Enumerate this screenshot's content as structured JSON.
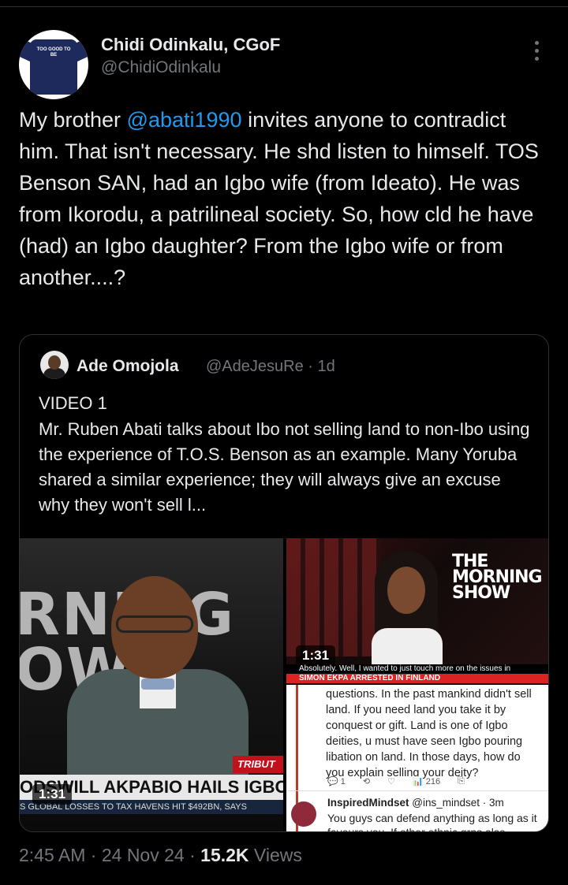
{
  "tweet": {
    "author_name": "Chidi Odinkalu, CGoF",
    "author_handle": "@ChidiOdinkalu",
    "avatar_text": "TOO GOOD TO BE",
    "text_before": "My brother ",
    "mention": "@abati1990",
    "text_after": " invites anyone to contradict him. That isn't necessary. He shd listen to himself. TOS Benson SAN, had an Igbo wife (from Ideato). He was from Ikorodu, a patrilineal society. So, how cld he have (had) an Igbo daughter? From the Igbo wife or from another....?",
    "time": "2:45 AM",
    "date": "24 Nov 24",
    "views_count": "15.2K",
    "views_label": "Views"
  },
  "quote": {
    "name": "Ade Omojola",
    "handle_time": "@AdeJesuRe · 1d",
    "label": "VIDEO 1",
    "text": "Mr. Ruben Abati talks about Ibo not selling land to non-Ibo using the experience of T.O.S. Benson as an example. Many Yoruba shared a similar experience; they will always give an excuse why they won't sell l..."
  },
  "media": {
    "left": {
      "duration": "1:31",
      "bg_text": "RNING OW",
      "badge": "TRIBUT",
      "ticker": "ODSWILL AKPABIO HAILS IGBO",
      "ticker2": "S GLOBAL LOSSES TO TAX HAVENS HIT $492BN, SAYS"
    },
    "top_right": {
      "duration": "1:31",
      "show_title": "THE MORNING SHOW",
      "subtitle": "Absolutely. Well, I wanted to just touch more on the issues in",
      "breaking": "SIMON EKPA ARRESTED IN FINLAND"
    },
    "bottom_right": {
      "content": "questions. In the past mankind didn't sell land. If you need land you take it by conquest or gift. Land is one of Igbo deities, u must have seen Igbo pouring libation on land. In those days, how do you explain selling your deity?",
      "stat_reply": "1",
      "stat_views": "216",
      "reply_name": "InspiredMindset",
      "reply_handle": "@ins_mindset · 3m",
      "reply_text": "You guys can defend anything as long as it favours you. If other ethnic grps also"
    }
  }
}
